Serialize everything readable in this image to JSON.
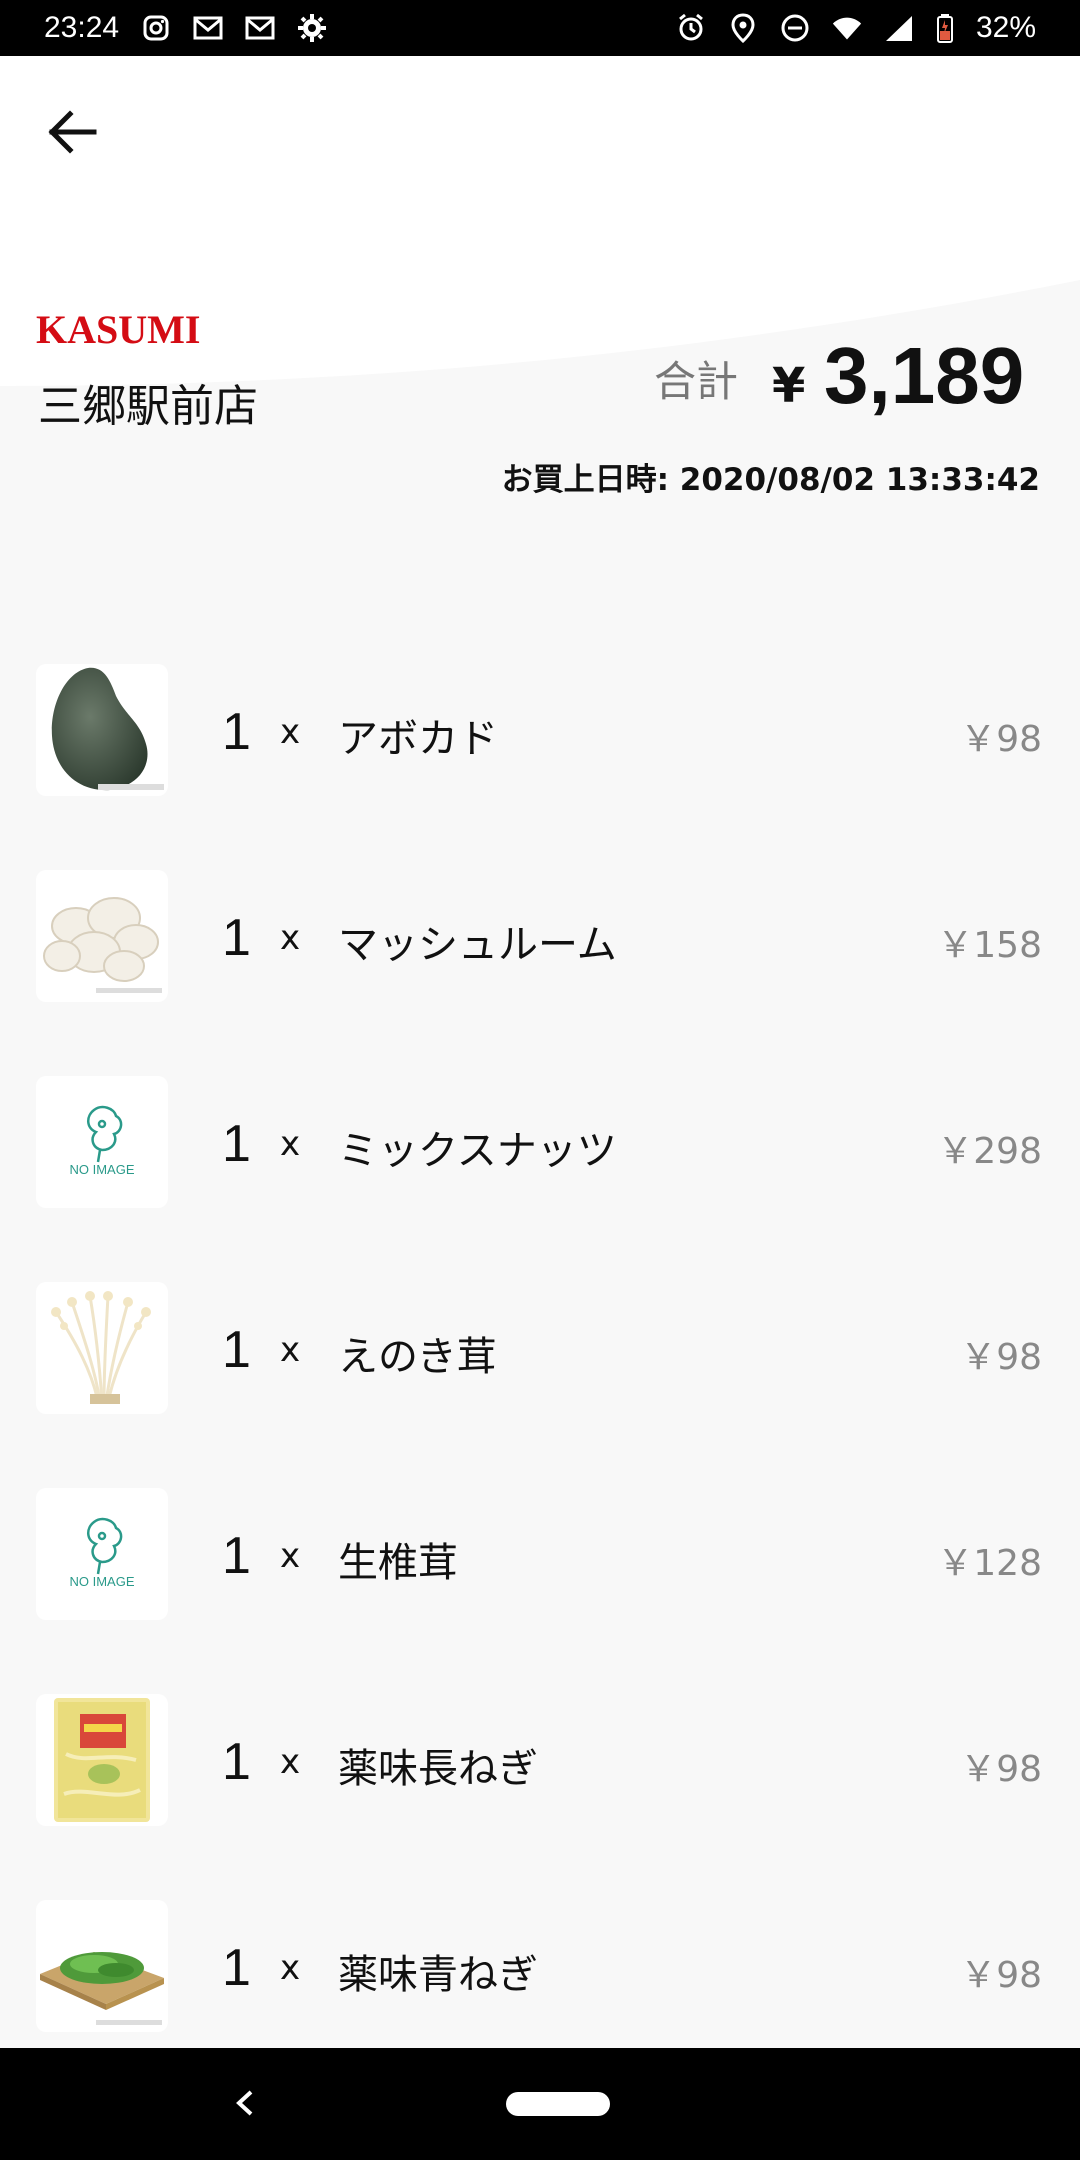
{
  "status_bar": {
    "time": "23:24",
    "battery": "32%",
    "left_icons": [
      "instagram-icon",
      "gmail-icon",
      "gmail-icon",
      "settings-icon"
    ],
    "right_icons": [
      "alarm-icon",
      "location-icon",
      "dnd-icon",
      "wifi-icon",
      "signal-icon",
      "battery-icon"
    ]
  },
  "header": {
    "brand": "KASUMI",
    "store": "三郷駅前店",
    "total_label": "合計",
    "currency": "¥",
    "total": "3,189",
    "purchase_date": "お買上日時: 2020/08/02 13:33:42"
  },
  "items": [
    {
      "qty": "1",
      "times": "x",
      "name": "アボカド",
      "price": "￥98",
      "image": "avocado"
    },
    {
      "qty": "1",
      "times": "x",
      "name": "マッシュルーム",
      "price": "￥158",
      "image": "mushroom"
    },
    {
      "qty": "1",
      "times": "x",
      "name": "ミックスナッツ",
      "price": "￥298",
      "image": "no-image"
    },
    {
      "qty": "1",
      "times": "x",
      "name": "えのき茸",
      "price": "￥98",
      "image": "enoki"
    },
    {
      "qty": "1",
      "times": "x",
      "name": "生椎茸",
      "price": "￥128",
      "image": "no-image"
    },
    {
      "qty": "1",
      "times": "x",
      "name": "薬味長ねぎ",
      "price": "￥98",
      "image": "leek-pack"
    },
    {
      "qty": "1",
      "times": "x",
      "name": "薬味青ねぎ",
      "price": "￥98",
      "image": "green-onion"
    }
  ],
  "no_image_text": "NO IMAGE",
  "colors": {
    "brand_red": "#d40c14",
    "no_image_green": "#2a9a8a"
  }
}
